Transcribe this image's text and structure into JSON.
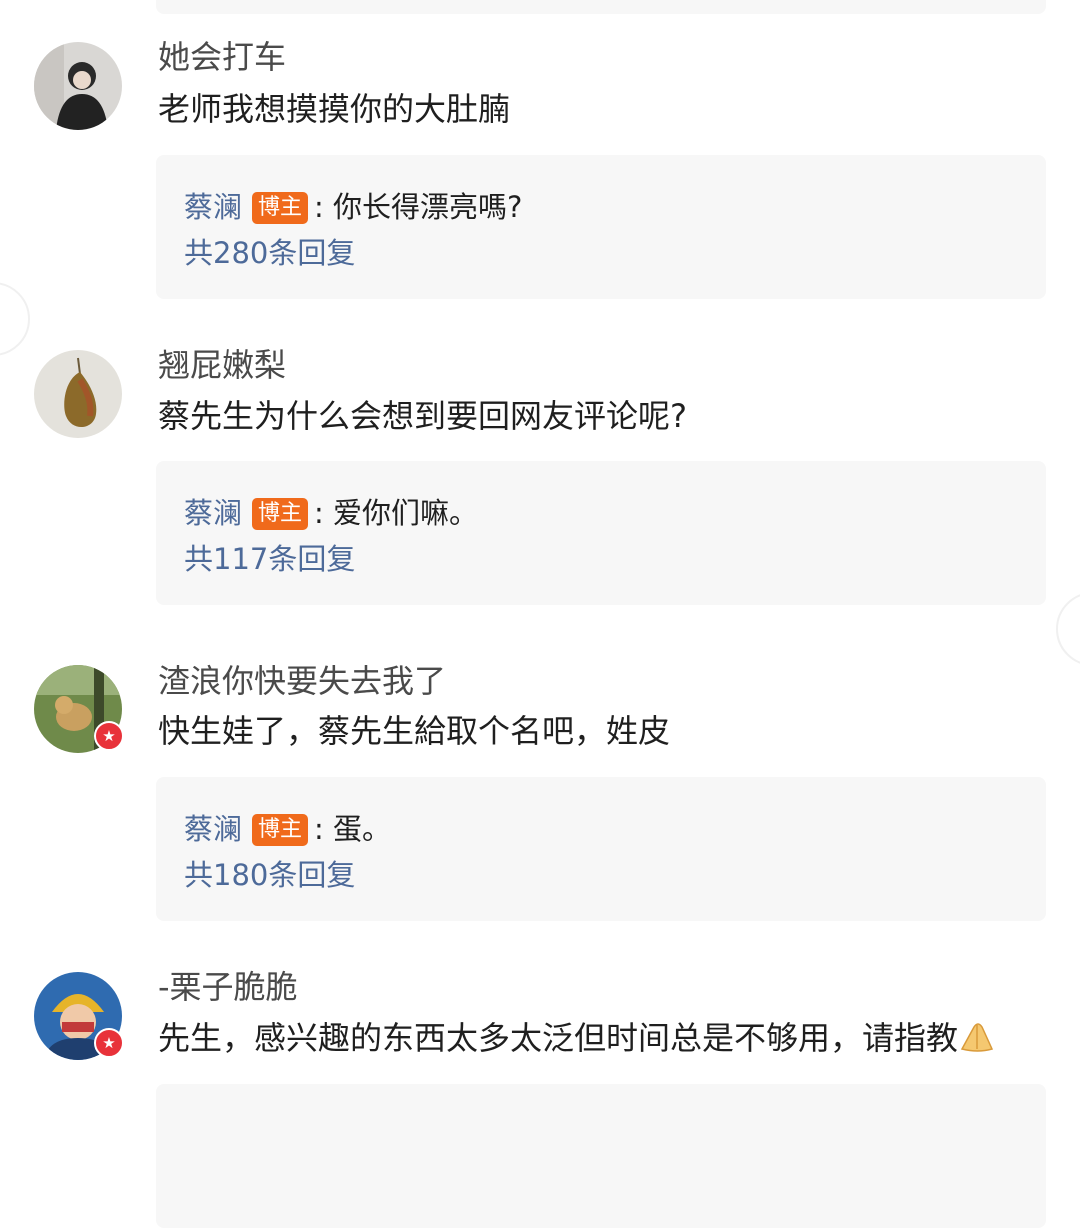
{
  "comments": [
    {
      "username": "她会打车",
      "text": "老师我想摸摸你的大肚腩",
      "reply": {
        "name": "蔡澜",
        "tag": "博主",
        "text": ": 你长得漂亮嗎?",
        "count": "共280条回复"
      },
      "verified": false
    },
    {
      "username": "翘屁嫩梨",
      "text": "蔡先生为什么会想到要回网友评论呢?",
      "reply": {
        "name": "蔡澜",
        "tag": "博主",
        "text": ": 爱你们嘛。",
        "count": "共117条回复"
      },
      "verified": false
    },
    {
      "username": "渣浪你快要失去我了",
      "text": "快生娃了，蔡先生給取个名吧，姓皮",
      "reply": {
        "name": "蔡澜",
        "tag": "博主",
        "text": ": 蛋。",
        "count": "共180条回复"
      },
      "verified": true
    },
    {
      "username": "-栗子脆脆",
      "text": "先生，感兴趣的东西太多太泛但时间总是不够用，请指教",
      "verified": true
    }
  ],
  "colors": {
    "link": "#4d6a99",
    "host_tag": "#f06a1b",
    "reply_bg": "#f7f7f7"
  },
  "icons": {
    "verified_badge": "star",
    "emoji": "folded-hands"
  }
}
